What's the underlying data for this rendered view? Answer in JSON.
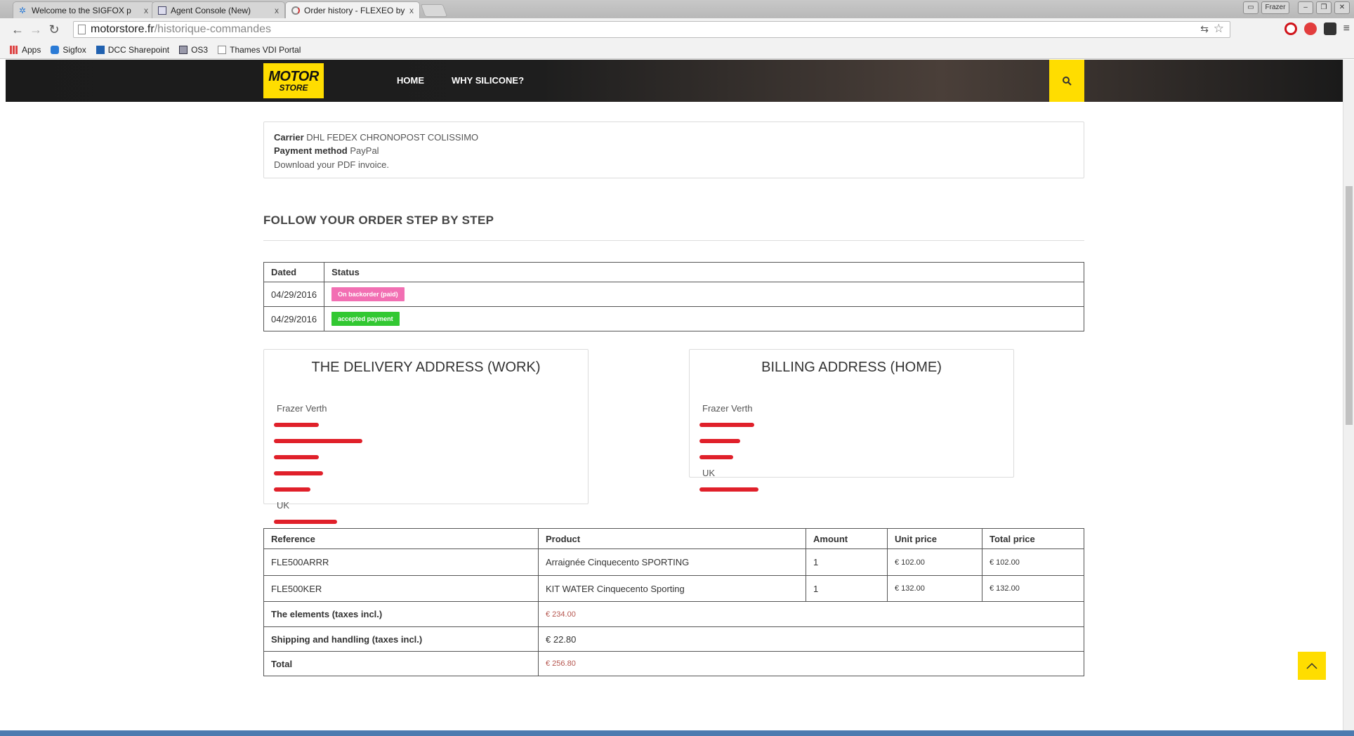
{
  "browser": {
    "tabs": [
      {
        "title": "Welcome to the SIGFOX p",
        "active": false
      },
      {
        "title": "Agent Console (New)",
        "active": false
      },
      {
        "title": "Order history - FLEXEO by",
        "active": true
      }
    ],
    "close_glyph": "x",
    "user_label": "Frazer",
    "url_domain": "motorstore.fr",
    "url_path": "/historique-commandes",
    "bookmarks": [
      "Apps",
      "Sigfox",
      "DCC Sharepoint",
      "OS3",
      "Thames VDI Portal"
    ]
  },
  "site": {
    "logo_line1": "MOTOR",
    "logo_line2": "STORE",
    "nav": [
      "HOME",
      "WHY SILICONE?"
    ],
    "accent": "#ffdd00"
  },
  "order_info": {
    "carrier_label": "Carrier",
    "carrier_value": "DHL FEDEX CHRONOPOST COLISSIMO",
    "payment_label": "Payment method",
    "payment_value": "PayPal",
    "invoice_text": "Download your PDF invoice."
  },
  "follow": {
    "title": "FOLLOW YOUR ORDER STEP BY STEP",
    "headers": [
      "Dated",
      "Status"
    ],
    "rows": [
      {
        "date": "04/29/2016",
        "status": "On backorder (paid)",
        "color": "#f26fb3"
      },
      {
        "date": "04/29/2016",
        "status": "accepted payment",
        "color": "#32c832"
      }
    ]
  },
  "delivery": {
    "title": "THE DELIVERY ADDRESS (WORK)",
    "name": "Frazer Verth",
    "country": "UK"
  },
  "billing": {
    "title": "BILLING ADDRESS (HOME)",
    "name": "Frazer Verth",
    "country": "UK"
  },
  "products": {
    "headers": [
      "Reference",
      "Product",
      "Amount",
      "Unit price",
      "Total price"
    ],
    "rows": [
      {
        "ref": "FLE500ARRR",
        "product": "Arraignée Cinquecento SPORTING",
        "amount": "1",
        "unit": "€ 102.00",
        "total": "€ 102.00"
      },
      {
        "ref": "FLE500KER",
        "product": "KIT WATER Cinquecento Sporting",
        "amount": "1",
        "unit": "€ 132.00",
        "total": "€ 132.00"
      }
    ],
    "elements_label": "The elements (taxes incl.)",
    "elements_value": "€ 234.00",
    "shipping_label": "Shipping and handling (taxes incl.)",
    "shipping_value": "€ 22.80",
    "total_label": "Total",
    "total_value": "€ 256.80"
  }
}
